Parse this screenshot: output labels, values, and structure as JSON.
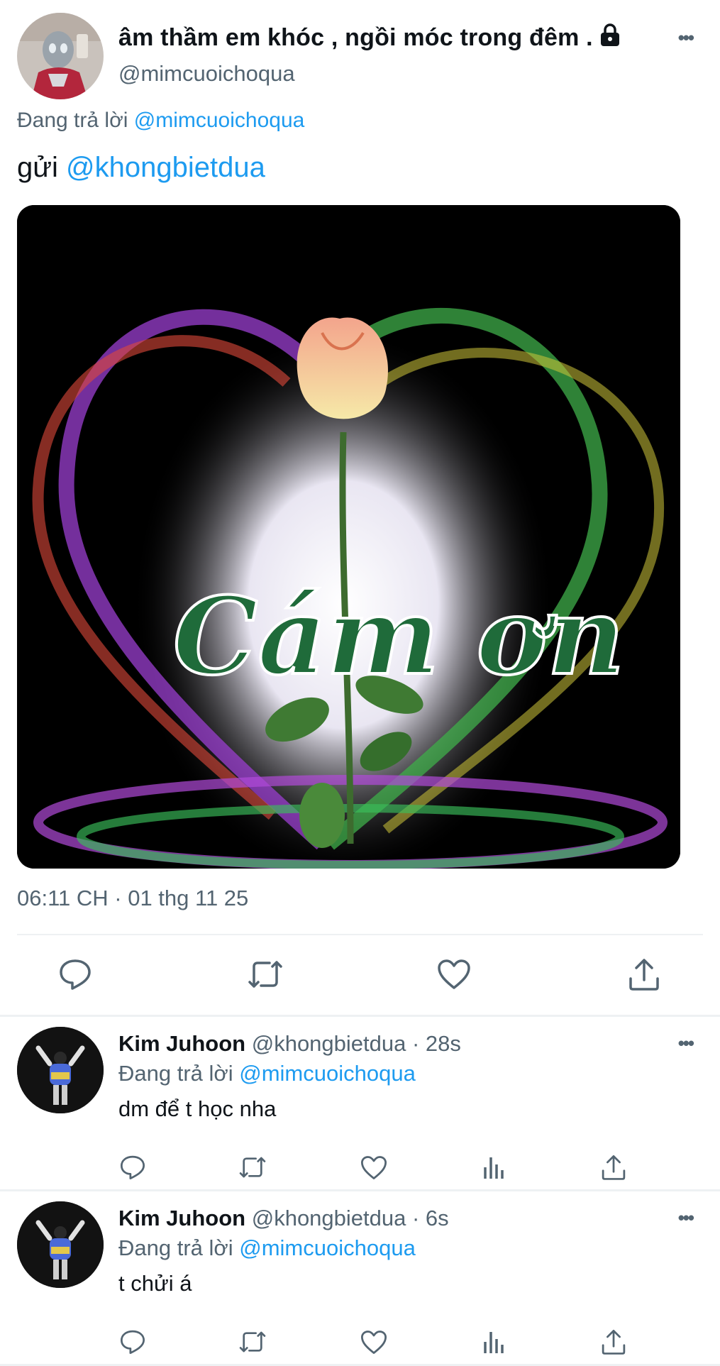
{
  "tweet": {
    "display_name": "âm thầm em khóc , ngồi móc trong đêm .",
    "handle": "@mimcuoichoqua",
    "replying_prefix": "Đang trả lời",
    "replying_to": "@mimcuoichoqua",
    "text_prefix": "gửi",
    "text_mention": "@khongbietdua",
    "media_overlay_text": "Cám ơn",
    "timestamp": "06:11 CH · 01 thg 11 25",
    "icons": [
      "lock-icon",
      "more-icon",
      "reply-icon",
      "retweet-icon",
      "like-icon",
      "share-icon"
    ]
  },
  "replies": [
    {
      "display_name": "Kim Juhoon",
      "meta": "@khongbietdua · 28s",
      "replying_prefix": "Đang trả lời",
      "replying_to": "@mimcuoichoqua",
      "text": "dm để t học nha"
    },
    {
      "display_name": "Kim Juhoon",
      "meta": "@khongbietdua · 6s",
      "replying_prefix": "Đang trả lời",
      "replying_to": "@mimcuoichoqua",
      "text": "t chửi á"
    }
  ],
  "colors": {
    "accent": "#1d9bf0",
    "secondary_text": "#536471",
    "primary_text": "#0f1419",
    "divider": "#eef1f3"
  }
}
